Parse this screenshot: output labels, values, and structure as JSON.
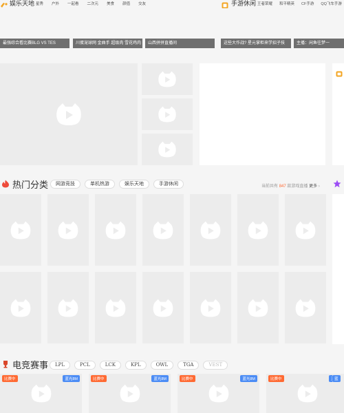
{
  "ent": {
    "title": "娱乐天地",
    "links": [
      "星秀",
      "户外",
      "一起看",
      "二次元",
      "美食",
      "颜值",
      "交友"
    ]
  },
  "mobile": {
    "title": "手游休闲",
    "links": [
      "王者荣耀",
      "和平精英",
      "CF手游",
      "QQ飞车手游"
    ]
  },
  "top_captions": [
    "最强综合看比赛BLG VS TES",
    "川蛋宠球网 金曲手 超级肉 雪花鸡肉",
    "山西拼拼直播间",
    "这些大作战? 星元掌柜来学招子技",
    "主播：闲鱼往梦一"
  ],
  "hot": {
    "title": "热门分类",
    "tabs": [
      "网游竞技",
      "单机热游",
      "娱乐天地",
      "手游休闲"
    ],
    "count_prefix": "当前共有",
    "count": "847",
    "count_suffix": "款游戏直播",
    "more": "更多"
  },
  "esports": {
    "title": "电竞赛事",
    "tabs": [
      "LPL",
      "PCL",
      "LCK",
      "KPL",
      "OWL",
      "TGA",
      "VEST"
    ],
    "badge_live": "比赛中",
    "badge_hd": "蓝光8M"
  },
  "colors": {
    "accent": "#ff6a33",
    "blue": "#4b8cf5"
  }
}
